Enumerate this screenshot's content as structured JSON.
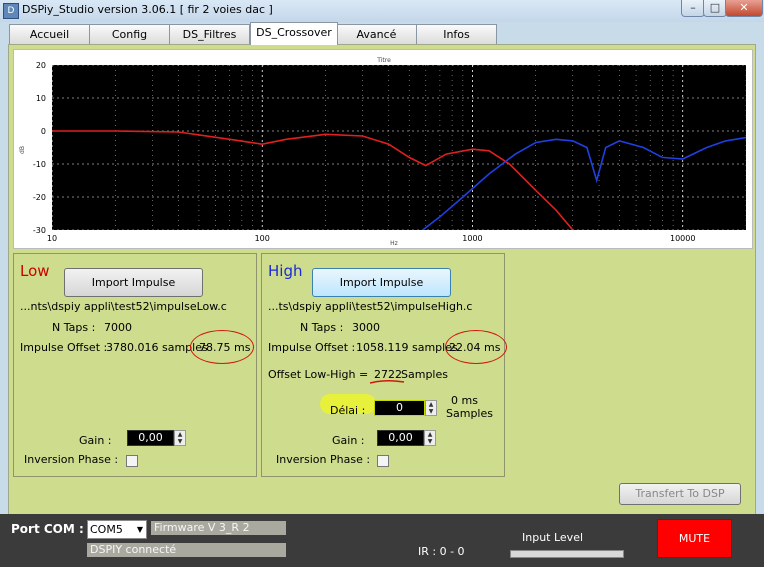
{
  "window": {
    "title": "DSPiy_Studio version 3.06.1 [ fir 2 voies dac ]"
  },
  "tabs": [
    "Accueil",
    "Config",
    "DS_Filtres",
    "DS_Crossover",
    "Avancé",
    "Infos"
  ],
  "chart_data": {
    "type": "line",
    "title": "Titre",
    "xlabel": "Hz",
    "ylabel": "dB",
    "xscale": "log",
    "xlim": [
      10,
      20000
    ],
    "ylim": [
      -30,
      20
    ],
    "x_ticks": [
      "10",
      "100",
      "1000",
      "10000"
    ],
    "y_ticks": [
      "20",
      "10",
      "0",
      "-10",
      "-20",
      "-30"
    ],
    "grid": true,
    "background": "#000000",
    "series": [
      {
        "color": "#e02020",
        "x": [
          10,
          20,
          40,
          70,
          100,
          130,
          200,
          300,
          400,
          500,
          600,
          750,
          1000,
          1200,
          1500,
          2000,
          2500,
          3000
        ],
        "y": [
          0,
          0,
          -0.3,
          -2.5,
          -4,
          -2.5,
          -1,
          -1.5,
          -4,
          -8,
          -10.5,
          -7,
          -5.5,
          -6,
          -10,
          -18,
          -24,
          -30
        ]
      },
      {
        "color": "#2040e0",
        "x": [
          580,
          700,
          900,
          1200,
          1600,
          2000,
          2500,
          3000,
          3500,
          3900,
          4300,
          5000,
          6500,
          8000,
          10000,
          13000,
          16000,
          20000
        ],
        "y": [
          -30,
          -26,
          -20,
          -13,
          -7,
          -3.5,
          -2.5,
          -3,
          -5,
          -15,
          -5,
          -3,
          -5,
          -8,
          -8.5,
          -5,
          -3,
          -2
        ]
      }
    ]
  },
  "low": {
    "title": "Low",
    "title_color": "#cc0000",
    "import_label": "Import Impulse",
    "file": "...nts\\dspiy appli\\test52\\impulseLow.c",
    "ntaps_label": "N Taps :",
    "ntaps": "7000",
    "offset_label": "Impulse Offset :",
    "offset_samples": "3780.016 samples",
    "offset_ms": "78.75 ms",
    "gain_label": "Gain :",
    "gain": "0,00",
    "inversion_label": "Inversion Phase :"
  },
  "high": {
    "title": "High",
    "title_color": "#1a2ad8",
    "import_label": "Import Impulse",
    "file": "...ts\\dspiy appli\\test52\\impulseHigh.c",
    "ntaps_label": "N Taps :",
    "ntaps": "3000",
    "offset_label": "Impulse Offset :",
    "offset_samples": "1058.119 samples",
    "offset_ms": "22.04 ms",
    "offset_lh_label": "Offset Low-High =",
    "offset_lh_value": "2722",
    "offset_lh_unit": "Samples",
    "delai_label": "Délai :",
    "delai": "0",
    "delai_ms": "0 ms",
    "delai_samples": "Samples",
    "gain_label": "Gain :",
    "gain": "0,00",
    "inversion_label": "Inversion Phase :"
  },
  "transfer_label": "Transfert To DSP",
  "footer": {
    "port_label": "Port COM :",
    "com_value": "COM5",
    "firmware": "Firmware V 3_R 2",
    "status": "DSPIY connecté",
    "ir": "IR : 0 - 0",
    "input_level_label": "Input Level",
    "mute_label": "MUTE"
  }
}
